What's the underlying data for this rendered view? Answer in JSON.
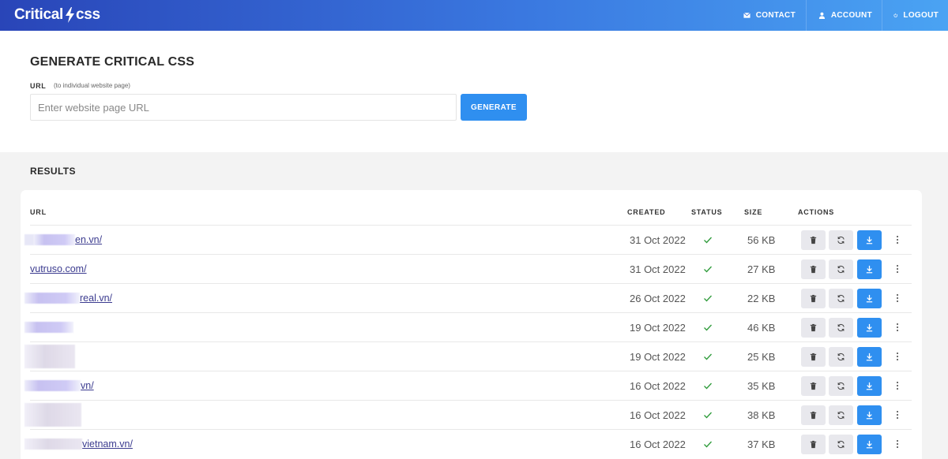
{
  "header": {
    "logo": {
      "text_left": "Critical",
      "text_right": "css"
    },
    "nav": [
      {
        "label": "CONTACT",
        "icon": "mail-icon"
      },
      {
        "label": "ACCOUNT",
        "icon": "user-icon"
      },
      {
        "label": "LOGOUT",
        "icon": "power-icon"
      }
    ]
  },
  "generate": {
    "title": "GENERATE CRITICAL CSS",
    "url_label": "URL",
    "url_hint": "(to individual website page)",
    "url_placeholder": "Enter website page URL",
    "url_value": "",
    "button": "GENERATE"
  },
  "results": {
    "title": "RESULTS",
    "columns": {
      "url": "URL",
      "created": "CREATED",
      "status": "STATUS",
      "size": "SIZE",
      "actions": "ACTIONS"
    },
    "rows": [
      {
        "url_visible": "en.vn/",
        "created": "31 Oct 2022",
        "status": "done",
        "size": "56 KB"
      },
      {
        "url_visible": "vutruso.com/",
        "created": "31 Oct 2022",
        "status": "done",
        "size": "27 KB"
      },
      {
        "url_visible": "real.vn/",
        "created": "26 Oct 2022",
        "status": "done",
        "size": "22 KB"
      },
      {
        "url_visible": "",
        "created": "19 Oct 2022",
        "status": "done",
        "size": "46 KB"
      },
      {
        "url_visible": "",
        "created": "19 Oct 2022",
        "status": "done",
        "size": "25 KB"
      },
      {
        "url_visible": "vn/",
        "created": "16 Oct 2022",
        "status": "done",
        "size": "35 KB"
      },
      {
        "url_visible": "",
        "created": "16 Oct 2022",
        "status": "done",
        "size": "38 KB"
      },
      {
        "url_visible": "vietnam.vn/",
        "created": "16 Oct 2022",
        "status": "done",
        "size": "37 KB"
      }
    ]
  },
  "colors": {
    "header_start": "#2945b8",
    "header_end": "#4aa3f3",
    "primary": "#2f8ff0",
    "check": "#2e9b3a",
    "link": "#3b3b8f"
  }
}
